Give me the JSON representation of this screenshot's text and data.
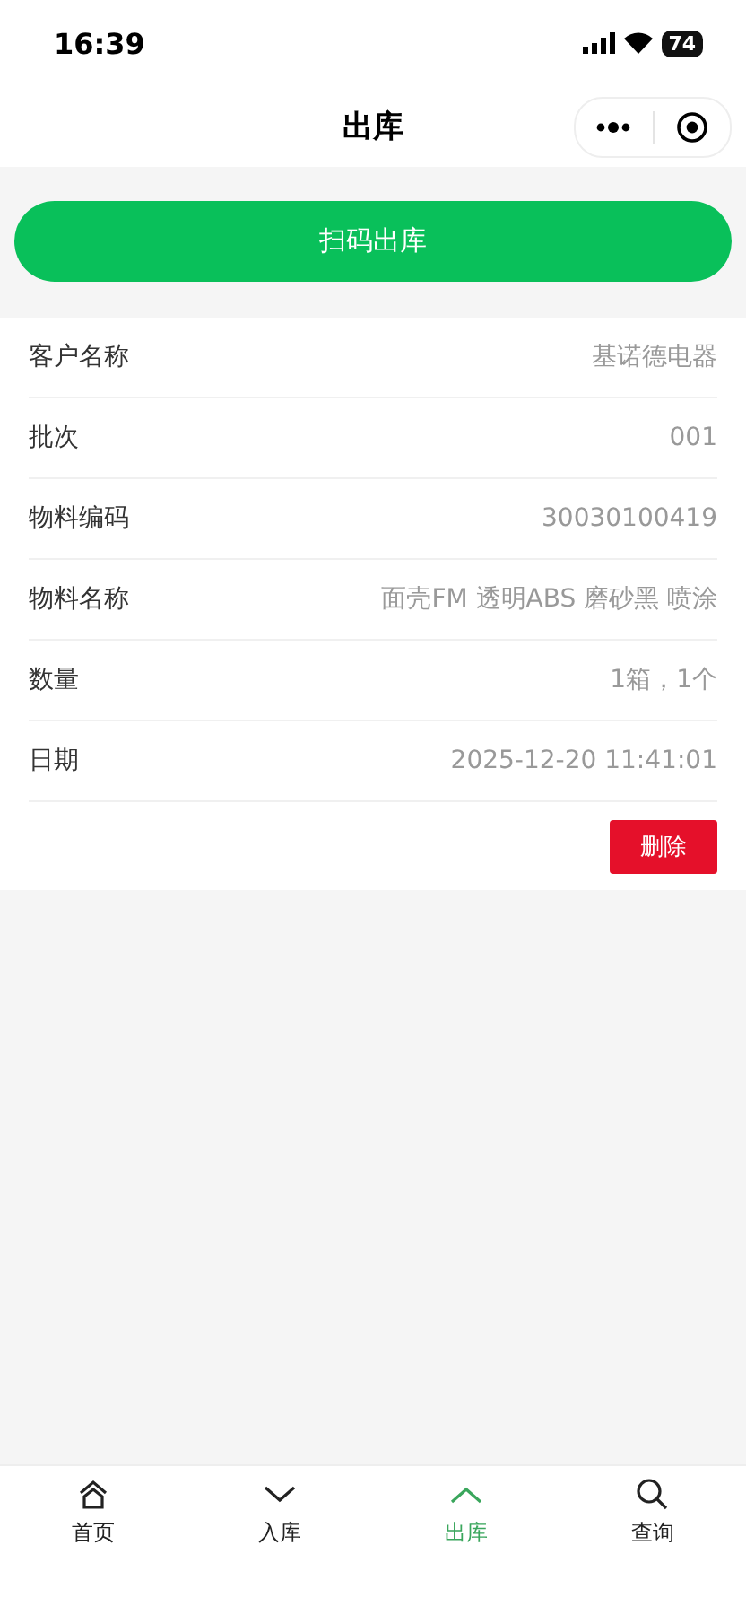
{
  "status_bar": {
    "time": "16:39",
    "battery": "74"
  },
  "nav": {
    "title": "出库"
  },
  "scan_button": {
    "label": "扫码出库"
  },
  "record": {
    "fields": [
      {
        "label": "客户名称",
        "value": "基诺德电器"
      },
      {
        "label": "批次",
        "value": "001"
      },
      {
        "label": "物料编码",
        "value": "30030100419"
      },
      {
        "label": "物料名称",
        "value": "面壳FM 透明ABS 磨砂黑 喷涂"
      },
      {
        "label": "数量",
        "value": "1箱，1个"
      },
      {
        "label": "日期",
        "value": "2025-12-20 11:41:01"
      }
    ],
    "delete_button": {
      "label": "删除"
    }
  },
  "tab_bar": [
    {
      "label": "首页",
      "kind": "home",
      "selected": false
    },
    {
      "label": "入库",
      "kind": "down",
      "selected": false
    },
    {
      "label": "出库",
      "kind": "up",
      "selected": true
    },
    {
      "label": "查询",
      "kind": "search",
      "selected": false
    }
  ]
}
